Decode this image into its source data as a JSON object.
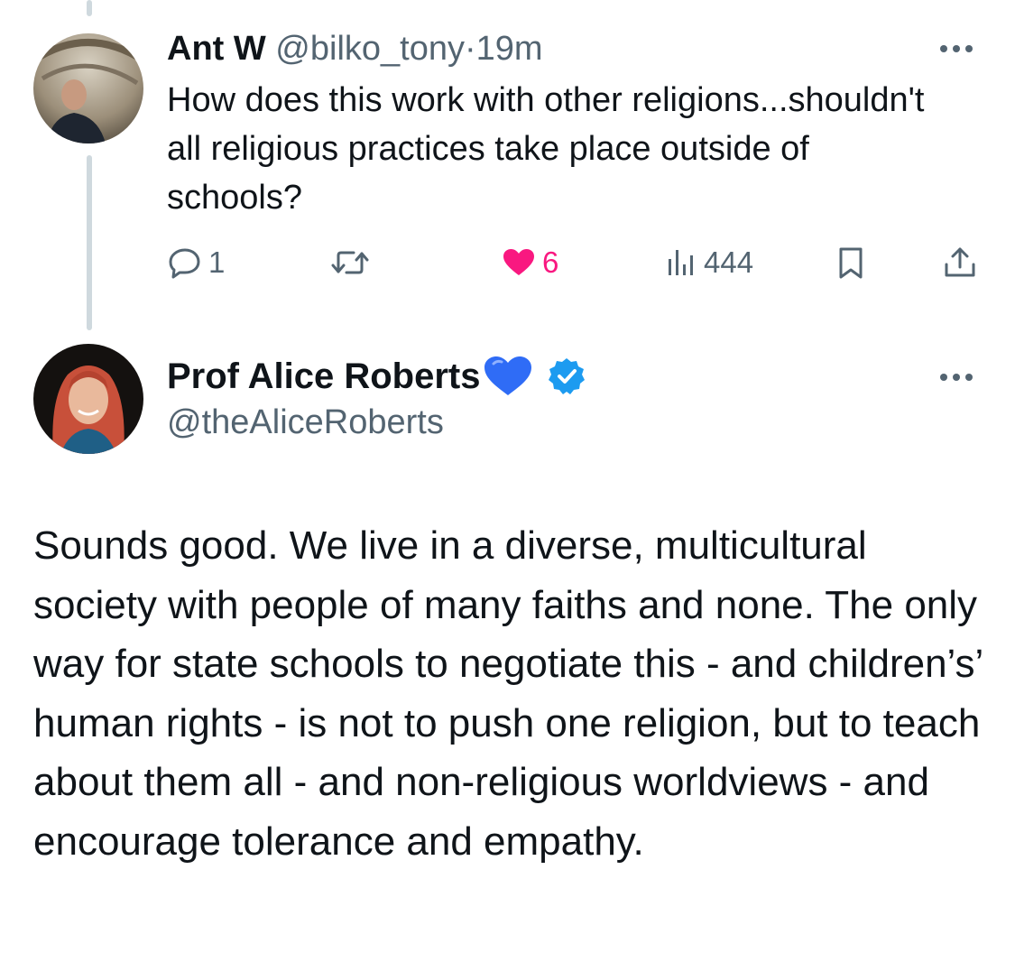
{
  "reply": {
    "display_name": "Ant W",
    "handle": "@bilko_tony",
    "separator": "·",
    "time": "19m",
    "text": "How does this work with other religions...shouldn't all religious practices take place outside of schools?",
    "stats": {
      "replies": "1",
      "retweets": "",
      "likes": "6",
      "views": "444"
    },
    "liked": true
  },
  "main_tweet": {
    "display_name": "Prof Alice Roberts",
    "name_emoji": "💙",
    "verified": true,
    "handle": "@theAliceRoberts",
    "text": "Sounds good. We live in a diverse, multicultural society with people of many faiths and none. The only way for state schools to negotiate this - and children’s’ human rights - is not to push one religion, but to teach about them all - and non-religious worldviews - and encourage tolerance and empathy."
  },
  "colors": {
    "text": "#0f1419",
    "muted": "#536471",
    "like": "#f91880",
    "verified": "#1d9bf0",
    "emoji_heart": "#2f6cf6",
    "thread_line": "#cfd9de"
  },
  "icons": {
    "reply": "speech-bubble-icon",
    "retweet": "retweet-icon",
    "like": "heart-icon",
    "views": "bar-chart-icon",
    "bookmark": "bookmark-icon",
    "share": "share-icon",
    "more": "more-dots-icon",
    "verified": "verified-badge-icon"
  }
}
